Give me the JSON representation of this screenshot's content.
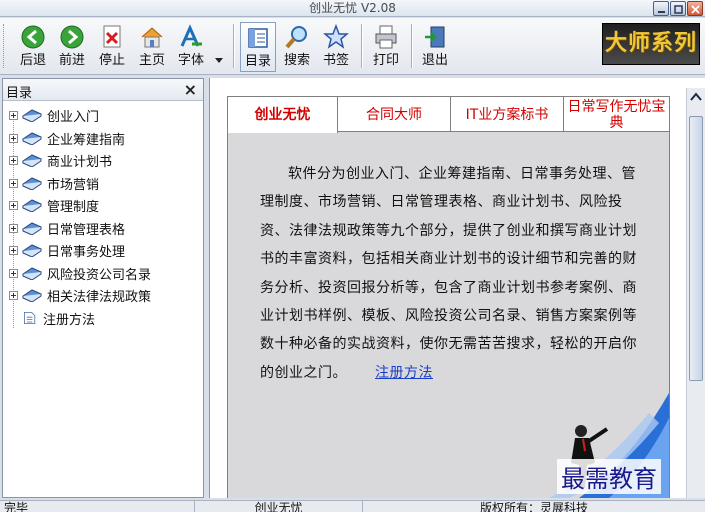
{
  "window": {
    "title": "创业无忧 V2.08"
  },
  "toolbar": {
    "buttons": [
      {
        "label": "后退",
        "icon": "back-arrow-icon"
      },
      {
        "label": "前进",
        "icon": "forward-arrow-icon"
      },
      {
        "label": "停止",
        "icon": "stop-icon"
      },
      {
        "label": "主页",
        "icon": "home-icon"
      },
      {
        "label": "字体",
        "icon": "font-icon"
      },
      {
        "label": "目录",
        "icon": "contents-icon"
      },
      {
        "label": "搜索",
        "icon": "search-icon"
      },
      {
        "label": "书签",
        "icon": "bookmark-star-icon"
      },
      {
        "label": "打印",
        "icon": "printer-icon"
      },
      {
        "label": "退出",
        "icon": "exit-door-icon"
      }
    ],
    "brand": "大师系列"
  },
  "sidebar": {
    "title": "目录",
    "close": "×",
    "items": [
      {
        "label": "创业入门"
      },
      {
        "label": "企业筹建指南"
      },
      {
        "label": "商业计划书"
      },
      {
        "label": "市场营销"
      },
      {
        "label": "管理制度"
      },
      {
        "label": "日常管理表格"
      },
      {
        "label": "日常事务处理"
      },
      {
        "label": "风险投资公司名录"
      },
      {
        "label": "相关法律法规政策"
      },
      {
        "label": "注册方法"
      }
    ]
  },
  "tabs": [
    {
      "label": "创业无忧"
    },
    {
      "label": "合同大师"
    },
    {
      "label": "IT业方案标书"
    },
    {
      "label": "日常写作无忧宝典"
    }
  ],
  "content": {
    "paragraph": "软件分为创业入门、企业筹建指南、日常事务处理、管理制度、市场营销、日常管理表格、商业计划书、风险投资、法律法规政策等九个部分，提供了创业和撰写商业计划书的丰富资料，包括相关商业计划书的设计细节和完善的财务分析、投资回报分析等，包含了商业计划书参考案例、商业计划书样例、模板、风险投资公司名录、销售方案案例等数十种必备的实战资料，使你无需苦苦搜求，轻松的开启你的创业之门。",
    "link": "注册方法",
    "watermark": "最需教育"
  },
  "status": {
    "cells": [
      "完毕",
      "创业无忧",
      "版权所有：灵展科技"
    ]
  },
  "colors": {
    "tab_text": "#d40000",
    "link": "#1a3fc7",
    "brand_gold": "#f2c83b"
  }
}
